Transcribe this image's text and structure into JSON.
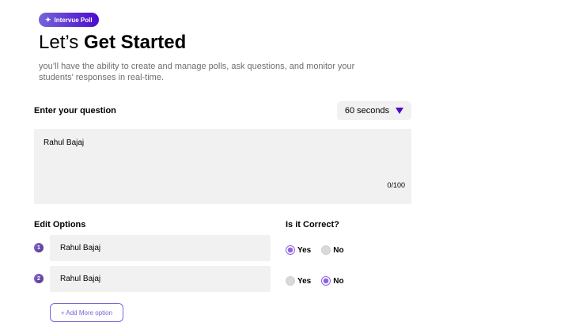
{
  "badge": {
    "icon": "sparkle-icon",
    "label": "Intervue Poll"
  },
  "header": {
    "title_light": "Let’s ",
    "title_bold": "Get Started",
    "subtitle": "you’ll have the ability to create and manage polls, ask questions, and monitor your students' responses in real-time."
  },
  "question": {
    "label": "Enter your question",
    "value": "Rahul Bajaj",
    "char_count": "0/100",
    "timer": {
      "selected": "60 seconds",
      "icon": "caret-down-icon"
    }
  },
  "options": {
    "label": "Edit Options",
    "correct_label": "Is it Correct?",
    "yes_label": "Yes",
    "no_label": "No",
    "items": [
      {
        "number": "1",
        "value": "Rahul Bajaj",
        "correct": "Yes"
      },
      {
        "number": "2",
        "value": "Rahul Bajaj",
        "correct": "No"
      }
    ],
    "add_button": "+ Add More option"
  },
  "colors": {
    "accent": "#7765da",
    "primary": "#4d0acd",
    "field_bg": "#f1f1f1",
    "muted_text": "#6e6e6e"
  }
}
